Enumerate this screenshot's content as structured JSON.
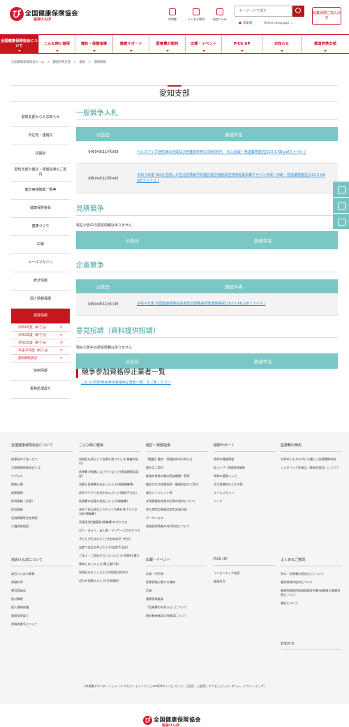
{
  "header": {
    "logo_main": "全国健康保険協会",
    "logo_sub": "協会けんぽ",
    "icons": [
      {
        "label": "申請書",
        "icon": "document-icon"
      },
      {
        "label": "よくある質問",
        "icon": "faq-icon"
      },
      {
        "label": "協会けんぽ",
        "icon": "building-icon"
      }
    ],
    "search_placeholder": "キーワードで探す",
    "lang_ja": "日本語",
    "lang_select": "Select language ⌄",
    "member_button": "就業保険ご加入の方"
  },
  "gnav": [
    "全国健康保険協会について",
    "こんな時に健保",
    "健診・保健指導",
    "健康サポート",
    "医療費の節約",
    "広報・イベント",
    "PICK UP",
    "お知らせ",
    "都道府県支部"
  ],
  "breadcrumb": [
    "全国健康保険協会ホーム",
    ">",
    "都道府県支部",
    ">",
    "愛知",
    ">",
    "調達情報"
  ],
  "page_title": "愛知支部",
  "sidebar": {
    "items": [
      "愛知支部からのお知らせ",
      "所在地・連絡先",
      "評議会",
      "愛知支部の健診・保健指導のご案内",
      "健診実施機関一覧等",
      "健康保険委員",
      "健康づくり",
      "広報",
      "メールマガジン",
      "統計情報",
      "個人情報保護"
    ],
    "active": "調達情報",
    "subitems": [
      "令和4年度（終了分）",
      "令和3年度（終了分）",
      "令和2年度（終了分）",
      "平成31年度（終了分）",
      "契約締結状況"
    ],
    "items_after": [
      "採用情報",
      "事務処理誤り"
    ]
  },
  "sections": {
    "general": {
      "title": "一般競争入札",
      "col_date": "公告日",
      "col_name": "調達件名",
      "rows": [
        {
          "date": "令和04年11月08日",
          "name": "ヘルスアップ通信簿の作成及び各種資料等の印刷(制作)・封入封緘・発送業務委託[215.1 KB pdfファイル ]"
        },
        {
          "date": "令和04年11月04日",
          "name": "令和４年度 GISを活用した生活習慣病予防健診受診者勧奨啓発用促進事業デザイン作成・印刷・発送業務委託[211.5 KB pdfファイル ]"
        }
      ]
    },
    "quote": {
      "title": "見積競争",
      "none": "現在公告中の調達情報はありません",
      "col_date": "公告日",
      "col_name": "調達件名"
    },
    "planning": {
      "title": "企画競争",
      "col_date": "公告日",
      "col_name": "調達件名",
      "rows": [
        {
          "date": "令和04年11月01日",
          "name": "令和４年度 全国健康保険協会愛知支部職員研修業務委託[163.6 KB pdfファイル ]"
        }
      ]
    },
    "opinion": {
      "title": "意見招請（資料提供招請）",
      "none": "現在公告中の調達情報はありません",
      "col_date": "公告日",
      "col_name": "調達件名"
    },
    "suspension": {
      "title": "競争参加資格停止業者一覧",
      "link": "こちら(本部)競争参加資格停止業者一覧）をご覧ください"
    }
  },
  "footer": {
    "columns": [
      {
        "head": "全国健康保険協会について",
        "links": [
          "理事長のごあいさつ",
          "全国健康保険協会とは",
          "アクセス",
          "情報公開",
          "調達情報",
          "採用情報（任意）",
          "採用情報",
          "役員報酬等支給規程",
          "介護保険制度"
        ]
      },
      {
        "head": "こんな時に健保",
        "links": [
          "保険証を提示して治療を受けるとき(療養の給付)",
          "医療費が高額になりそうなとき(限度額適用認定)",
          "高額な医療費を支払ったとき(高額療養費)",
          "病気やケガで会社を休んだとき(傷病手当金)",
          "医療費の全額を負担したとき(療養費)",
          "海外で急な病気にかかって治療を受けたとき(海外療養費)",
          "再連型(型)重義務(療養費)のかかり方",
          "はり・きゅう、あん摩・マッサージのかかり方",
          "子どもが生まれたとき(出産育児一時金)",
          "出産で会社を休んだとき(出産手当金)",
          "ご本人・ご家族がなくなったとき(埋葬料(費))",
          "事故にあったとき(第三者行為)",
          "保険証をなくしたとき(保険証再交付)",
          "会社を退職するとき(任意継続)"
        ]
      },
      {
        "head": "健診・保健指導",
        "links": [
          "【重要】健診・保健指導のお知らせ",
          "健診のご案内",
          "都道府県等の健診実施機関一覧等",
          "健診の生活保健指導・健康相談のご案内",
          "健診パンフレット等",
          "大規模健診結果の犯罪の提供について",
          "第三期特定健康診査等実施計画",
          "データヘルス",
          "保健指導情報の共同利用について"
        ]
      },
      {
        "head": "健康サポート",
        "links": [
          "季節の健康情報",
          "知っトク! 医療保険情報",
          "季節の健康レシピ",
          "生活習慣病もとの予防",
          "メールマガジン",
          "リンク"
        ]
      },
      {
        "head": "医療費の節約",
        "links": [
          "お財布にもカラダにも優しい医療費節約術",
          "ジェネリック医薬品（後発医薬品）について"
        ]
      }
    ],
    "columns2": [
      {
        "head": "協会けんぽについて",
        "links": [
          "協会けんぽの事業",
          "保険料率",
          "運営委員会",
          "統計情報",
          "個人情報保護",
          "事務処理誤り",
          "保険者番号について"
        ]
      },
      {
        "head": "",
        "links": []
      },
      {
        "head": "広報・イベント",
        "links": [
          "広報・刊行物",
          "医療保険に関する情報",
          "広報",
          "健康保険委員",
          "「医療費のお知らせ」について",
          "被扶養者確認の再確認について"
        ]
      },
      {
        "head": "PICK UP",
        "links": [
          "インセンティブ制度",
          "健康宣言"
        ]
      },
      {
        "head": "よくあるご質問",
        "links": [
          "窓口・申請書の提出などについて",
          "健康保険の給付について",
          "健康保険被保険者資格証明書(退職後の健康保険)について",
          "健診について"
        ]
      }
    ],
    "notices": "お知らせ",
    "bar": "| 申請書ダウンロード | メールマガジン | リンク | このWEBサイトについて | ご意見・ご提案 | アクセシビリティポリシー | サイトマップ |"
  }
}
